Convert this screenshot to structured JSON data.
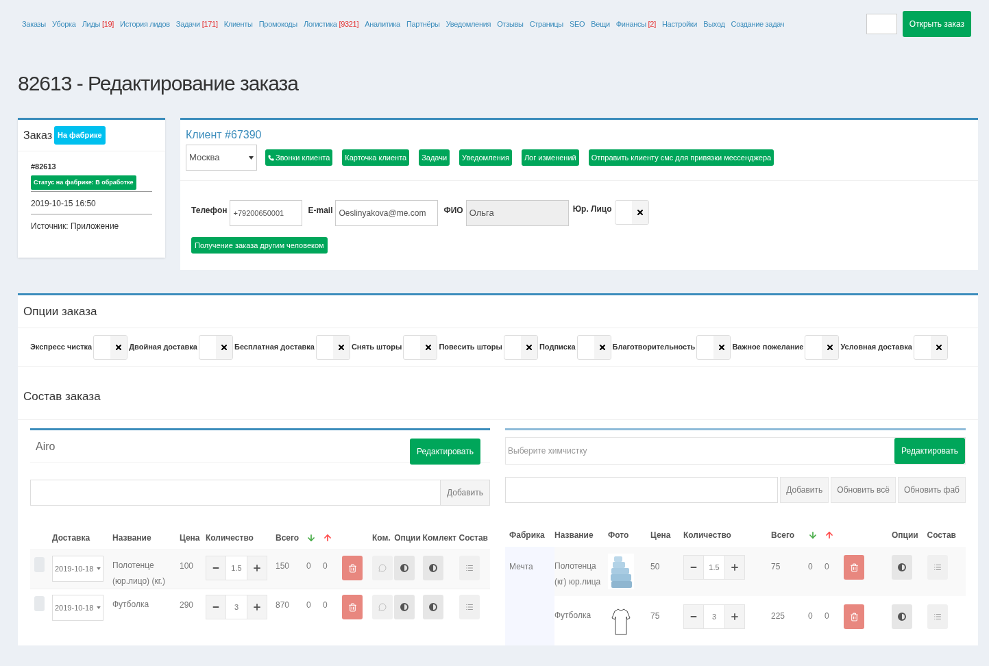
{
  "nav": {
    "links": [
      {
        "label": "Заказы"
      },
      {
        "label": "Уборка"
      },
      {
        "label": "Лиды",
        "count": "[19]"
      },
      {
        "label": "История лидов"
      },
      {
        "label": "Задачи",
        "count": "[171]"
      },
      {
        "label": "Клиенты"
      },
      {
        "label": "Промокоды"
      },
      {
        "label": "Логистика",
        "count": "[9321]"
      },
      {
        "label": "Аналитика"
      },
      {
        "label": "Партнёры"
      },
      {
        "label": "Уведомления"
      },
      {
        "label": "Отзывы"
      },
      {
        "label": "Страницы"
      },
      {
        "label": "SEO"
      },
      {
        "label": "Вещи"
      },
      {
        "label": "Финансы",
        "count": "[2]"
      },
      {
        "label": "Настройки"
      },
      {
        "label": "Выход"
      },
      {
        "label": "Создание задач"
      }
    ],
    "open_button": "Открыть заказ"
  },
  "title": "82613 - Редактирование заказа",
  "order_card": {
    "title": "Заказ",
    "badge": "На фабрике",
    "number": "#82613",
    "status": "Статус на фабрике: В обработке",
    "date": "2019-10-15 16:50",
    "source": "Источник: Приложение"
  },
  "client_card": {
    "title": "Клиент #67390",
    "city": "Москва",
    "buttons": [
      {
        "label": "Звонки клиента",
        "kind": "phone"
      },
      {
        "label": "Карточка клиента",
        "kind": "plain"
      },
      {
        "label": "Задачи",
        "kind": "plain"
      },
      {
        "label": "Уведомления",
        "kind": "plain"
      },
      {
        "label": "Лог изменений",
        "kind": "plain"
      },
      {
        "label": "Отправить клиенту смс для привязки мессенджера",
        "kind": "plain"
      }
    ],
    "phone_label": "Телефон",
    "phone": "+79200650001",
    "email_label": "E-mail",
    "email": "Oeslinyakova@me.com",
    "name_label": "ФИО",
    "name": "Ольга",
    "legal_label": "Юр. Лицо",
    "legal_on": false,
    "other_receiver_button": "Получение заказа другим человеком"
  },
  "options": {
    "title": "Опции заказа",
    "items": [
      {
        "label": "Экспресс чистка",
        "on": false
      },
      {
        "label": "Двойная доставка",
        "on": false
      },
      {
        "label": "Бесплатная доставка",
        "on": false
      },
      {
        "label": "Снять шторы",
        "on": false
      },
      {
        "label": "Повесить шторы",
        "on": false
      },
      {
        "label": "Подписка",
        "on": false
      },
      {
        "label": "Благотворительность",
        "on": false
      },
      {
        "label": "Важное пожелание",
        "on": false
      },
      {
        "label": "Условная доставка",
        "on": false
      }
    ]
  },
  "composition": {
    "title": "Состав заказа",
    "left": {
      "title": "Airo",
      "edit_button": "Редактировать",
      "add_button": "Добавить",
      "columns_a": [
        "Доставка",
        "Название",
        "Цена",
        "Количество",
        "Всего"
      ],
      "columns_b": [
        "Ком.",
        "Опции",
        "Комлект",
        "Состав"
      ],
      "rows": [
        {
          "selected": false,
          "date": "2019-10-18",
          "name": "Полотенце (юр.лицо) (кг.)",
          "price": "100",
          "qty": "1.5",
          "total": "150",
          "down": "0",
          "up": "0"
        },
        {
          "selected": false,
          "date": "2019-10-18",
          "name": "Футболка",
          "price": "290",
          "qty": "3",
          "total": "870",
          "down": "0",
          "up": "0"
        }
      ]
    },
    "right": {
      "factory_placeholder": "Выберите химчистку",
      "edit_button": "Редактировать",
      "add_button": "Добавить",
      "update_all_button": "Обновить всё",
      "update_factory_button": "Обновить фаб",
      "columns_a": [
        "Фабрика",
        "Название",
        "Фото",
        "Цена",
        "Количество",
        "Всего"
      ],
      "columns_b": [
        "Опции",
        "Состав"
      ],
      "factory": "Мечта",
      "rows": [
        {
          "name": "Полотенца (кг) юр.лица",
          "price": "50",
          "qty": "1.5",
          "total": "75",
          "down": "0",
          "up": "0"
        },
        {
          "name": "Футболка",
          "price": "75",
          "qty": "3",
          "total": "225",
          "down": "0",
          "up": "0"
        }
      ]
    }
  }
}
